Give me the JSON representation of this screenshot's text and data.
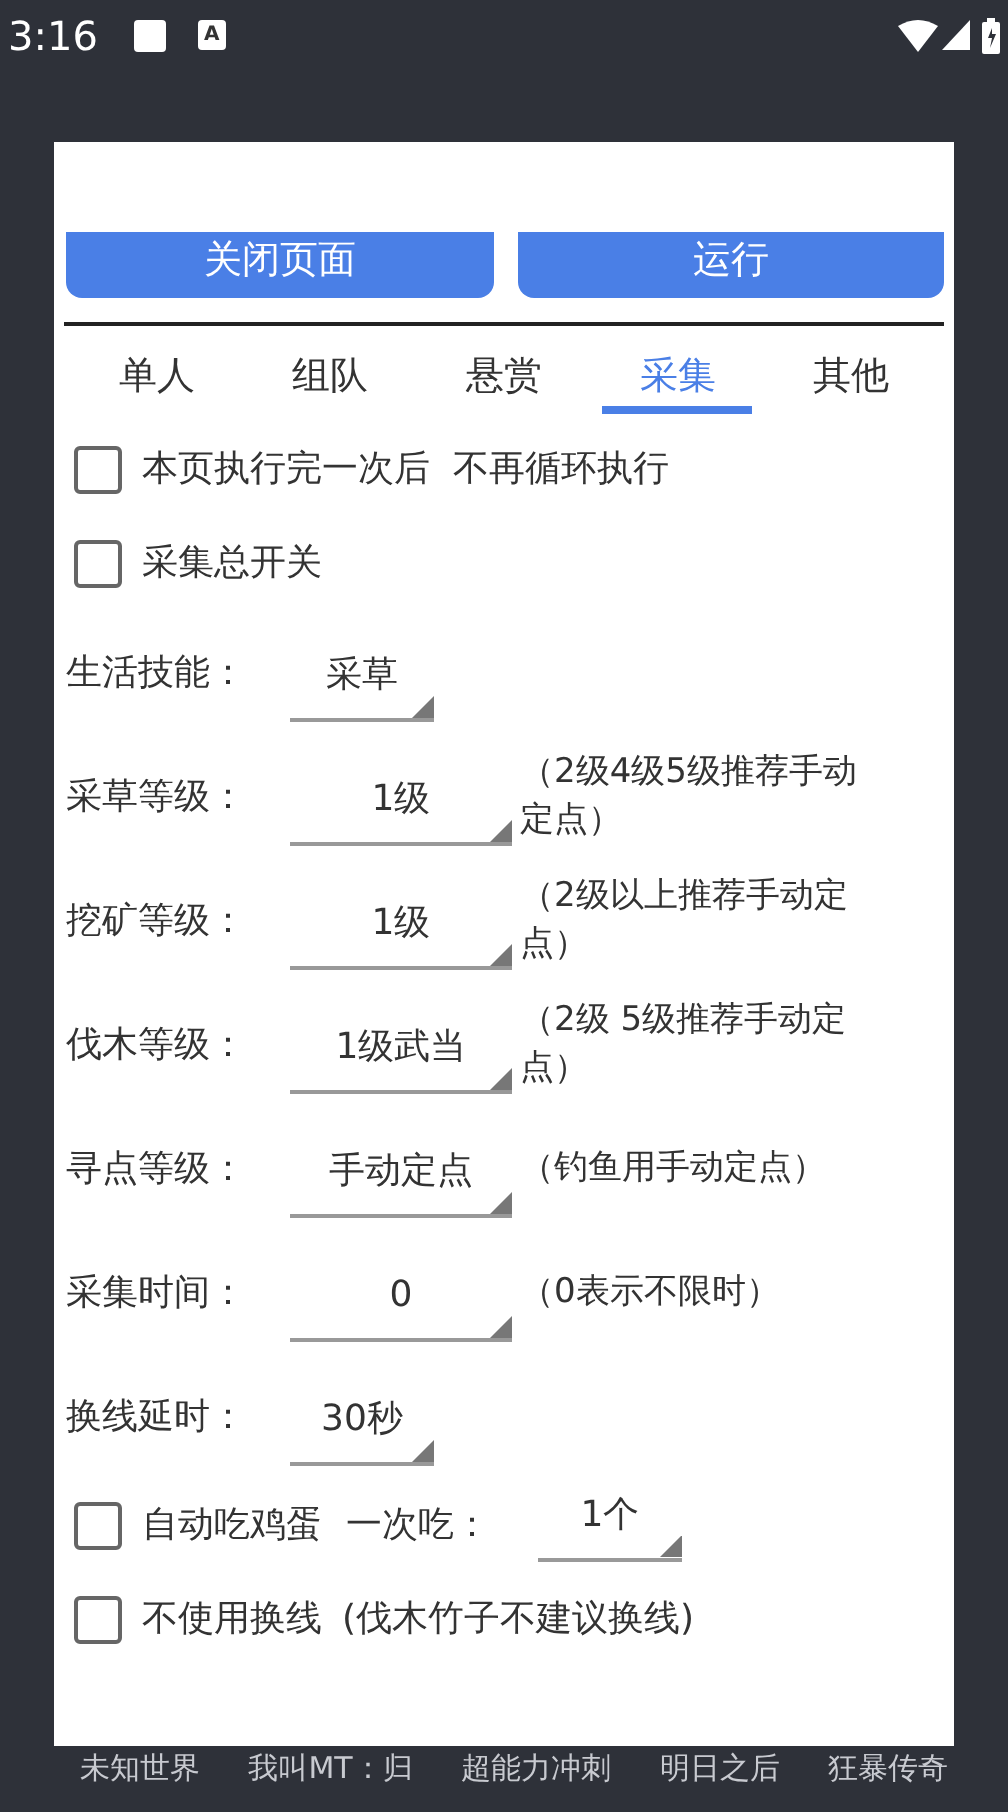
{
  "status_bar": {
    "time": "3:16",
    "notification_glyph": "A"
  },
  "buttons": [
    {
      "label": "关闭页面"
    },
    {
      "label": "运行"
    }
  ],
  "tabs": [
    {
      "label": "单人",
      "selected": false
    },
    {
      "label": "组队",
      "selected": false
    },
    {
      "label": "悬赏",
      "selected": false
    },
    {
      "label": "采集",
      "selected": true
    },
    {
      "label": "其他",
      "selected": false
    }
  ],
  "rows": [
    {
      "kind": "checkbox",
      "label": "本页执行完一次后  不再循环执行",
      "checked": false
    },
    {
      "kind": "checkbox",
      "label": "采集总开关",
      "checked": false
    },
    {
      "kind": "spinner",
      "label": "生活技能：",
      "value": "采草"
    },
    {
      "kind": "spinner",
      "label": "采草等级：",
      "value": "1级",
      "note": "（2级4级5级推荐手动定点）"
    },
    {
      "kind": "spinner",
      "label": "挖矿等级：",
      "value": "1级",
      "note": "（2级以上推荐手动定点）"
    },
    {
      "kind": "spinner",
      "label": "伐木等级：",
      "value": "1级武当",
      "note": "（2级 5级推荐手动定点）"
    },
    {
      "kind": "spinner",
      "label": "寻点等级：",
      "value": "手动定点",
      "note": "（钓鱼用手动定点）"
    },
    {
      "kind": "spinner",
      "label": "采集时间：",
      "value": "0",
      "note": "（0表示不限时）"
    },
    {
      "kind": "spinner",
      "label": "换线延时：",
      "value": "30秒"
    },
    {
      "kind": "checkbox",
      "label": "自动吃鸡蛋",
      "checked": false,
      "extra_label": "一次吃：",
      "extra_value": "1个"
    },
    {
      "kind": "checkbox",
      "label": "不使用换线",
      "checked": false,
      "note": "(伐木竹子不建议换线)"
    }
  ],
  "background_apps": [
    "未知世界",
    "我叫MT：归",
    "超能力冲刺",
    "明日之后",
    "狂暴传奇"
  ]
}
